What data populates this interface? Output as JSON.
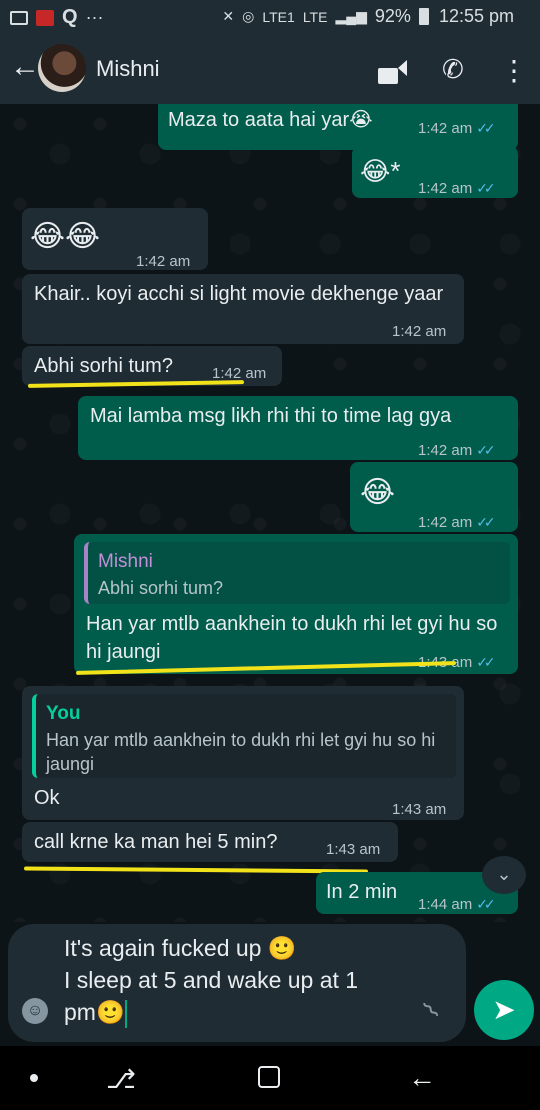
{
  "status_bar": {
    "battery": "92%",
    "time": "12:55 pm",
    "network": "LTE",
    "network2": "LTE1",
    "more": "···"
  },
  "header": {
    "contact_name": "Mishni"
  },
  "messages": [
    {
      "text": "Maza to aata hai yar😭",
      "time": "1:42 am",
      "dir": "out"
    },
    {
      "text": "😂*",
      "time": "1:42 am",
      "dir": "out"
    },
    {
      "text": "😂😂",
      "time": "1:42 am",
      "dir": "in"
    },
    {
      "text": "Khair.. koyi acchi si light movie dekhenge yaar",
      "time": "1:42 am",
      "dir": "in"
    },
    {
      "text": "Abhi sorhi tum?",
      "time": "1:42 am",
      "dir": "in"
    },
    {
      "text": "Mai lamba msg likh rhi thi to time lag gya",
      "time": "1:42 am",
      "dir": "out"
    },
    {
      "text": "😂",
      "time": "1:42 am",
      "dir": "out"
    },
    {
      "quote_author": "Mishni",
      "quote_text": "Abhi sorhi tum?",
      "text": "Han yar mtlb aankhein to dukh rhi let gyi hu so hi jaungi",
      "time": "1:43 am",
      "dir": "out"
    },
    {
      "quote_author": "You",
      "quote_text": "Han yar mtlb aankhein to dukh rhi let gyi hu so hi jaungi",
      "text": "Ok",
      "time": "1:43 am",
      "dir": "in"
    },
    {
      "text": "call krne ka man hei 5 min?",
      "time": "1:43 am",
      "dir": "in"
    },
    {
      "text": "In 2 min",
      "time": "1:44 am",
      "dir": "out"
    }
  ],
  "composer": {
    "line1": "It's again fucked up 🙂",
    "line2": "I sleep at 5 and wake up at 1",
    "line3": "pm🙂"
  },
  "colors": {
    "outgoing": "#005c4b",
    "incoming": "#1f2c34",
    "accent": "#00a884",
    "highlight": "#f2e21a",
    "ticks": "#53bdeb"
  },
  "icons": [
    "back-arrow-icon",
    "video-call-icon",
    "phone-icon",
    "more-vert-icon",
    "scroll-down-icon",
    "emoji-icon",
    "attach-icon",
    "send-icon"
  ]
}
